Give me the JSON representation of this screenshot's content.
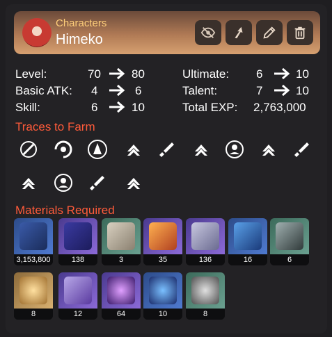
{
  "header": {
    "subtitle": "Characters",
    "title": "Himeko",
    "buttons": [
      "eye-slash-icon",
      "share-icon",
      "edit-icon",
      "trash-icon"
    ]
  },
  "stats": {
    "level": {
      "label": "Level:",
      "from": "70",
      "to": "80"
    },
    "basic_atk": {
      "label": "Basic ATK:",
      "from": "4",
      "to": "6"
    },
    "skill": {
      "label": "Skill:",
      "from": "6",
      "to": "10"
    },
    "ultimate": {
      "label": "Ultimate:",
      "from": "6",
      "to": "10"
    },
    "talent": {
      "label": "Talent:",
      "from": "7",
      "to": "10"
    },
    "total_exp": {
      "label": "Total EXP:",
      "value": "2,763,000"
    }
  },
  "sections": {
    "traces": "Traces to Farm",
    "materials": "Materials Required"
  },
  "traces": [
    "basic-atk-trace-icon",
    "skill-trace-icon",
    "ultimate-trace-icon",
    "stat-atk-icon",
    "stat-sword-icon",
    "stat-atk-icon",
    "talent-trace-icon",
    "stat-atk-icon",
    "stat-sword-icon",
    "stat-atk-icon",
    "talent-trace-icon",
    "stat-sword-icon",
    "stat-atk-icon"
  ],
  "materials": [
    {
      "name": "credit-icon",
      "count": "3,153,800",
      "rarity": "blue"
    },
    {
      "name": "exp-book-icon",
      "count": "138",
      "rarity": "purple"
    },
    {
      "name": "scroll-icon",
      "count": "3",
      "rarity": "green"
    },
    {
      "name": "crystal-shard-icon",
      "count": "35",
      "rarity": "purple"
    },
    {
      "name": "silver-key-icon",
      "count": "136",
      "rarity": "purple"
    },
    {
      "name": "blue-key-icon",
      "count": "16",
      "rarity": "blue"
    },
    {
      "name": "dark-key-icon",
      "count": "6",
      "rarity": "green"
    },
    {
      "name": "compass-icon",
      "count": "8",
      "rarity": "gold"
    },
    {
      "name": "crown-fragment-icon",
      "count": "12",
      "rarity": "purple"
    },
    {
      "name": "purple-core-icon",
      "count": "64",
      "rarity": "purple"
    },
    {
      "name": "blue-core-icon",
      "count": "10",
      "rarity": "blue"
    },
    {
      "name": "shell-icon",
      "count": "8",
      "rarity": "green"
    }
  ],
  "colors": {
    "accent": "#ff5b3a",
    "header_gold": "#ffcf7a"
  }
}
